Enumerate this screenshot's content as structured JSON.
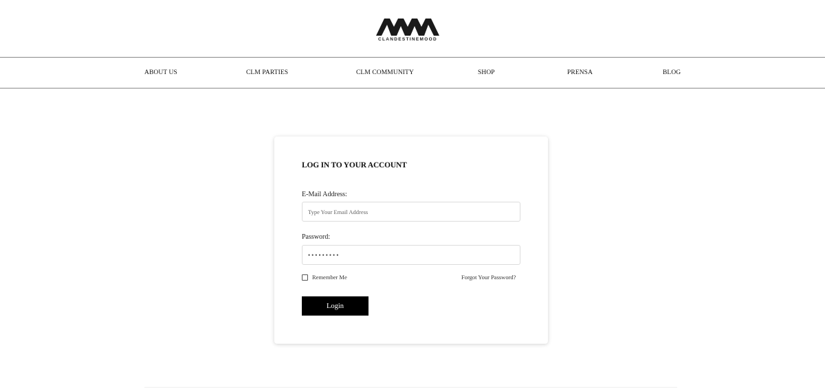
{
  "brand": {
    "name": "CLANDESTINEMOOD"
  },
  "nav": {
    "items": [
      {
        "label": "ABOUT US"
      },
      {
        "label": "CLM PARTIES"
      },
      {
        "label": "CLM COMMUNITY"
      },
      {
        "label": "SHOP"
      },
      {
        "label": "PRENSA"
      },
      {
        "label": "BLOG"
      }
    ]
  },
  "login": {
    "title": "LOG IN TO YOUR ACCOUNT",
    "email_label": "E-Mail Address:",
    "email_placeholder": "Type Your Email Address",
    "email_value": "",
    "password_label": "Password:",
    "password_value": "•••••••••",
    "remember_label": "Remember Me",
    "remember_checked": false,
    "forgot_label": "Forgot Your Password?",
    "submit_label": "Login"
  },
  "colors": {
    "accent": "#000000",
    "text": "#111111",
    "border": "#8a8a8a"
  }
}
